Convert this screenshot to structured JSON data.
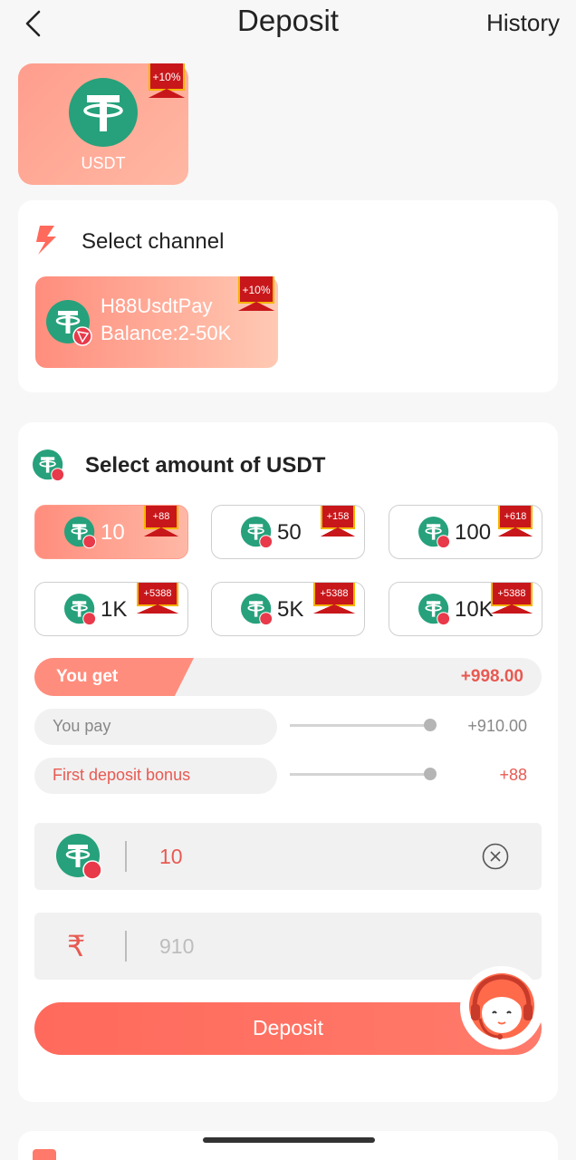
{
  "header": {
    "title": "Deposit",
    "history_label": "History"
  },
  "methods": [
    {
      "label": "USDT",
      "badge": "+10%"
    }
  ],
  "channel_section": {
    "title": "Select channel",
    "channels": [
      {
        "name": "H88UsdtPay",
        "balance": "Balance:2-50K",
        "badge": "+10%"
      }
    ]
  },
  "amount_section": {
    "title": "Select amount of USDT",
    "options": [
      {
        "value": "10",
        "bonus": "+88",
        "selected": true
      },
      {
        "value": "50",
        "bonus": "+158",
        "selected": false
      },
      {
        "value": "100",
        "bonus": "+618",
        "selected": false
      },
      {
        "value": "1K",
        "bonus": "+5388",
        "selected": false
      },
      {
        "value": "5K",
        "bonus": "+5388",
        "selected": false
      },
      {
        "value": "10K",
        "bonus": "+5388",
        "selected": false
      }
    ],
    "you_get_label": "You get",
    "you_get_value": "+998.00",
    "you_pay_label": "You pay",
    "you_pay_value": "+910.00",
    "bonus_label": "First deposit bonus",
    "bonus_value": "+88",
    "usdt_input_value": "10",
    "inr_input_value": "910",
    "currency_symbol": "₹",
    "deposit_label": "Deposit"
  },
  "colors": {
    "accent": "#ff6a5c",
    "accent_text": "#e85a52",
    "usdt_green": "#26a17b",
    "badge_red": "#c8171b"
  },
  "icons": {
    "back": "chevron-left-icon",
    "coin": "tether-icon",
    "tron": "tron-icon",
    "bolt": "lightning-icon",
    "clear": "clear-circle-icon",
    "support": "customer-service-icon"
  }
}
